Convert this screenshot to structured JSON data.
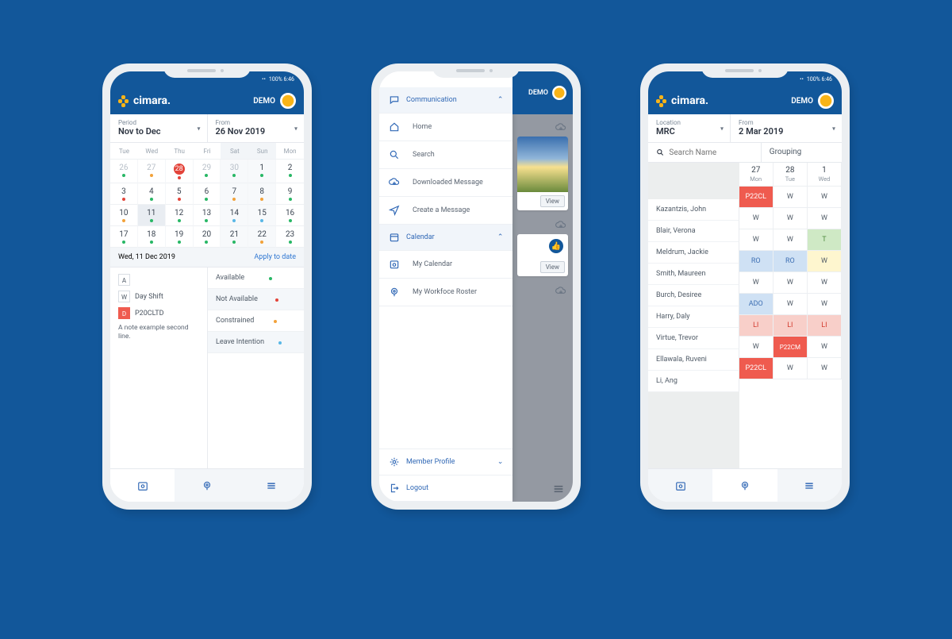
{
  "brand": "cimara.",
  "header": {
    "demo": "DEMO"
  },
  "status": "100%  6:46",
  "phone1": {
    "period_label": "Period",
    "period_value": "Nov to Dec",
    "from_label": "From",
    "from_value": "26 Nov 2019",
    "weekdays": [
      "Tue",
      "Wed",
      "Thu",
      "Fri",
      "Sat",
      "Sun",
      "Mon"
    ],
    "weeks": [
      [
        {
          "n": "26",
          "d": "g",
          "o": true
        },
        {
          "n": "27",
          "d": "o",
          "o": true
        },
        {
          "n": "28",
          "d": "r",
          "o": true,
          "c": true
        },
        {
          "n": "29",
          "d": "g",
          "o": true
        },
        {
          "n": "30",
          "d": "g",
          "o": true,
          "we": true
        },
        {
          "n": "1",
          "d": "g",
          "we": true
        },
        {
          "n": "2",
          "d": "g"
        }
      ],
      [
        {
          "n": "3",
          "d": "r"
        },
        {
          "n": "4",
          "d": "g"
        },
        {
          "n": "5",
          "d": "r"
        },
        {
          "n": "6",
          "d": "g"
        },
        {
          "n": "7",
          "d": "o",
          "we": true
        },
        {
          "n": "8",
          "d": "o",
          "we": true
        },
        {
          "n": "9",
          "d": "g"
        }
      ],
      [
        {
          "n": "10",
          "d": "o"
        },
        {
          "n": "11",
          "d": "g",
          "today": true
        },
        {
          "n": "12",
          "d": "g"
        },
        {
          "n": "13",
          "d": "g"
        },
        {
          "n": "14",
          "d": "bl",
          "we": true
        },
        {
          "n": "15",
          "d": "bl",
          "we": true
        },
        {
          "n": "16",
          "d": "g"
        }
      ],
      [
        {
          "n": "17",
          "d": "g"
        },
        {
          "n": "18",
          "d": "g"
        },
        {
          "n": "19",
          "d": "g"
        },
        {
          "n": "20",
          "d": "g"
        },
        {
          "n": "21",
          "d": "g",
          "we": true
        },
        {
          "n": "22",
          "d": "o",
          "we": true
        },
        {
          "n": "23",
          "d": "g"
        }
      ]
    ],
    "selected_date": "Wed, 11 Dec 2019",
    "apply": "Apply to date",
    "codes": [
      {
        "b": "A",
        "t": ""
      },
      {
        "b": "W",
        "t": "Day Shift"
      },
      {
        "b": "D",
        "t": "P20CLTD",
        "red": true
      }
    ],
    "note": "A note example second line.",
    "legend": [
      {
        "t": "Available",
        "d": "g"
      },
      {
        "t": "Not Available",
        "d": "r",
        "alt": true
      },
      {
        "t": "Constrained",
        "d": "o"
      },
      {
        "t": "Leave Intention",
        "d": "bl",
        "alt": true
      }
    ]
  },
  "phone2": {
    "sections": {
      "comm_title": "Communication",
      "comm": [
        "Home",
        "Search",
        "Downloaded Message",
        "Create a Message"
      ],
      "cal_title": "Calendar",
      "cal": [
        "My Calendar",
        "My Workfoce Roster"
      ],
      "profile": "Member Profile",
      "logout": "Logout"
    },
    "bd_demo": "DEMO",
    "view": "View"
  },
  "phone3": {
    "loc_label": "Location",
    "loc_value": "MRC",
    "from_label": "From",
    "from_value": "2 Mar 2019",
    "search_ph": "Search Name",
    "grouping": "Grouping",
    "days": [
      {
        "n": "27",
        "d": "Mon"
      },
      {
        "n": "28",
        "d": "Tue"
      },
      {
        "n": "1",
        "d": "Wed"
      }
    ],
    "rows": [
      {
        "name": "Kazantzis, John",
        "c": [
          {
            "t": "P22CL",
            "cls": "c-redf"
          },
          {
            "t": "W"
          },
          {
            "t": "W"
          }
        ]
      },
      {
        "name": "Blair, Verona",
        "c": [
          {
            "t": "W"
          },
          {
            "t": "W"
          },
          {
            "t": "W"
          }
        ]
      },
      {
        "name": "Meldrum, Jackie",
        "c": [
          {
            "t": "W"
          },
          {
            "t": "W"
          },
          {
            "t": "T",
            "cls": "c-green"
          }
        ]
      },
      {
        "name": "Smith, Maureen",
        "c": [
          {
            "t": "RO",
            "cls": "c-blue"
          },
          {
            "t": "RO",
            "cls": "c-blue"
          },
          {
            "t": "W",
            "cls": "c-yellow"
          }
        ]
      },
      {
        "name": "Burch, Desiree",
        "c": [
          {
            "t": "W"
          },
          {
            "t": "W"
          },
          {
            "t": "W"
          }
        ]
      },
      {
        "name": "Harry, Daly",
        "c": [
          {
            "t": "ADO",
            "cls": "c-blue"
          },
          {
            "t": "W"
          },
          {
            "t": "W"
          }
        ]
      },
      {
        "name": "Virtue, Trevor",
        "c": [
          {
            "t": "LI",
            "cls": "c-red"
          },
          {
            "t": "LI",
            "cls": "c-red"
          },
          {
            "t": "LI",
            "cls": "c-red"
          }
        ]
      },
      {
        "name": "Ellawala, Ruveni",
        "c": [
          {
            "t": "W"
          },
          {
            "t": "P22CM",
            "cls": "c-redm"
          },
          {
            "t": "W"
          }
        ]
      },
      {
        "name": "Li, Ang",
        "c": [
          {
            "t": "P22CL",
            "cls": "c-redf"
          },
          {
            "t": "W"
          },
          {
            "t": "W"
          }
        ]
      }
    ]
  }
}
